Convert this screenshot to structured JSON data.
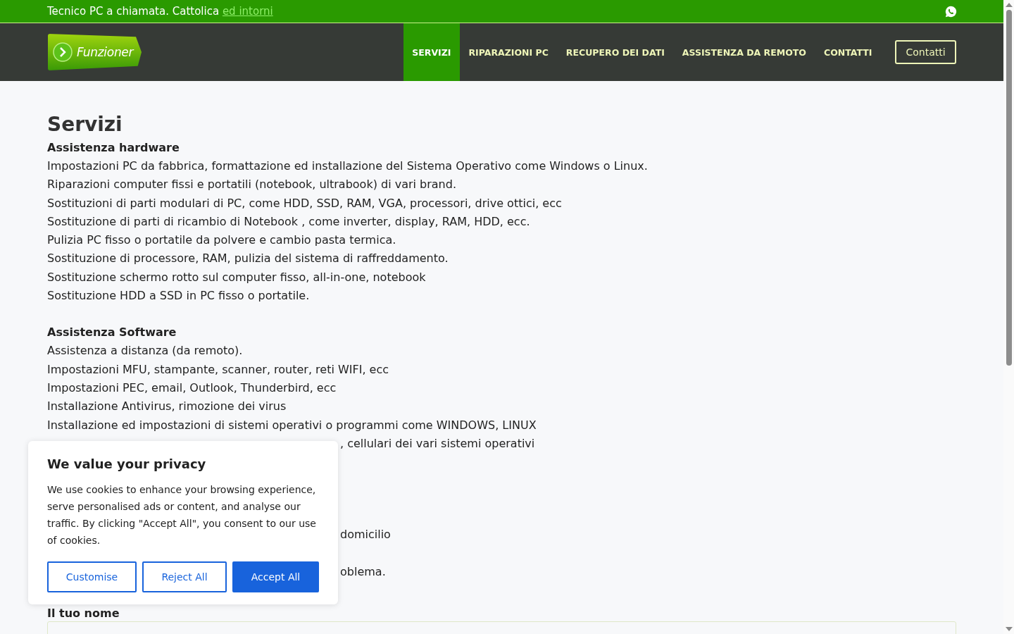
{
  "top_bar": {
    "text": "Tecnico PC a chiamata. Cattolica",
    "link": "ed intorni"
  },
  "header": {
    "logo_text": "Funzioner",
    "nav": [
      {
        "label": "SERVIZI",
        "selected": true
      },
      {
        "label": "RIPARAZIONI PC",
        "selected": false
      },
      {
        "label": "RECUPERO DEI DATI",
        "selected": false
      },
      {
        "label": "ASSISTENZA DA REMOTO",
        "selected": false
      },
      {
        "label": "CONTATTI",
        "selected": false
      }
    ],
    "button": "Contatti"
  },
  "page_title": "Servizi",
  "sections": [
    {
      "heading": "Assistenza hardware",
      "lines": [
        "Impostazioni PC da fabbrica, formattazione ed installazione del Sistema Operativo come Windows o Linux.",
        "Riparazioni computer fissi e portatili (notebook, ultrabook) di vari brand.",
        "Sostituzioni di parti modulari di PC, come HDD, SSD, RAM, VGA, processori, drive ottici, ecc",
        "Sostituzione di parti di ricambio di Notebook , come inverter, display, RAM, HDD, ecc.",
        "Pulizia PC fisso o portatile da polvere e cambio pasta termica.",
        "Sostituzione di processore, RAM, pulizia del sistema di raffreddamento.",
        "Sostituzione schermo rotto sul computer fisso, all-in-one, notebook",
        "Sostituzione HDD a SSD in PC fisso o portatile."
      ]
    },
    {
      "heading": "Assistenza Software",
      "lines": [
        "Assistenza a distanza (da remoto).",
        "Impostazioni MFU, stampante, scanner, router, reti WIFI, ecc",
        "Impostazioni PEC, email, Outlook, Thunderbird, ecc",
        "Installazione Antivirus, rimozione dei virus",
        "Installazione ed impostazioni di sistemi operativi o programmi come WINDOWS, LINUX"
      ]
    }
  ],
  "covered_fragments": [
    ", cellulari dei vari sistemi operativi",
    "domicilio",
    "oblema."
  ],
  "form": {
    "name_label": "Il tuo nome"
  },
  "cookie_banner": {
    "title": "We value your privacy",
    "text": "We use cookies to enhance your browsing experience, serve personalised ads or content, and analyse our traffic. By clicking \"Accept All\", you consent to our use of cookies.",
    "buttons": [
      {
        "label": "Customise",
        "kind": "outline"
      },
      {
        "label": "Reject All",
        "kind": "outline"
      },
      {
        "label": "Accept All",
        "kind": "primary"
      }
    ]
  }
}
